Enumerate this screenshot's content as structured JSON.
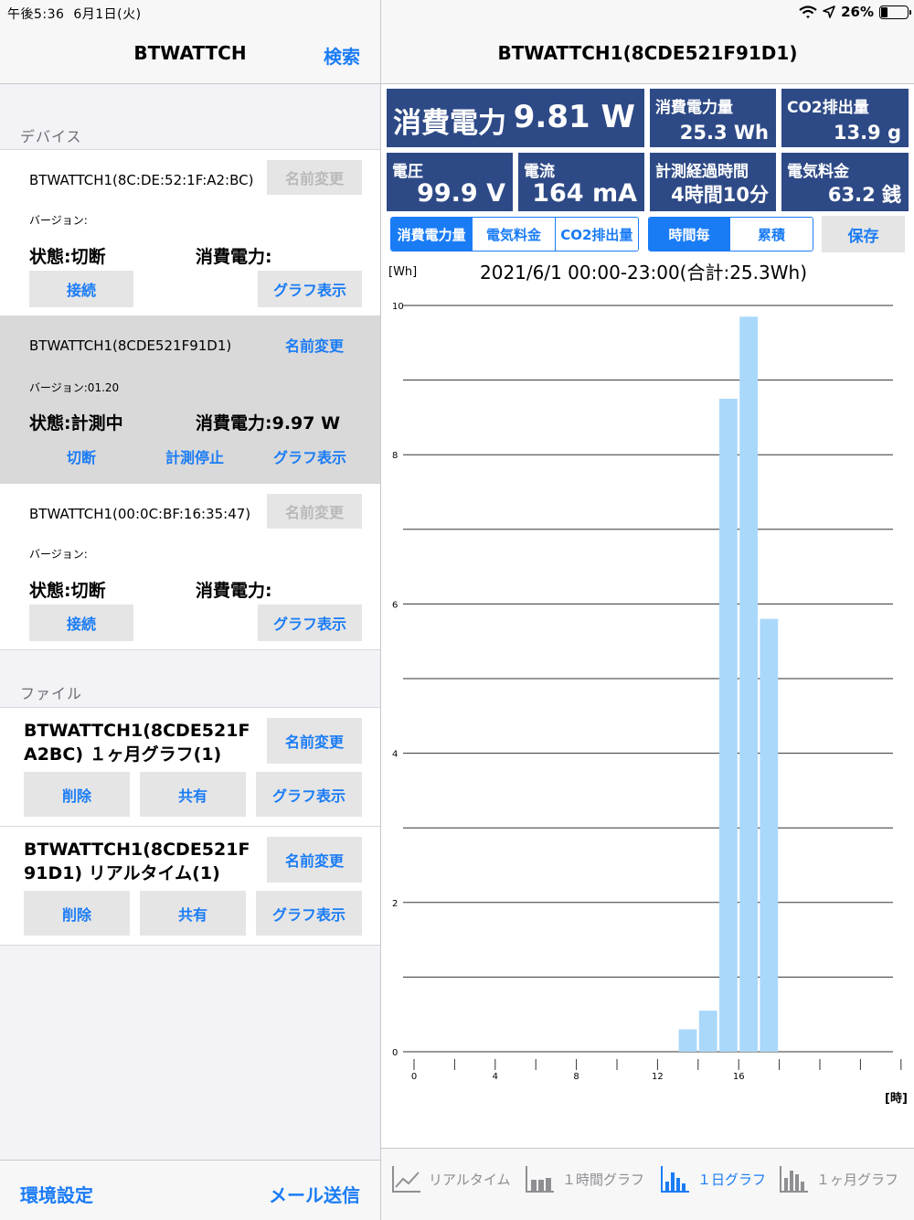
{
  "status": {
    "time": "午後5:36",
    "date": "6月1日(火)",
    "battery": "26%"
  },
  "left": {
    "nav": {
      "title": "BTWATTCH",
      "search_label": "検索"
    },
    "devices_header": "デバイス",
    "devices": [
      {
        "name": "BTWATTCH1(8C:DE:52:1F:A2:BC)",
        "rename": "名前変更",
        "version": "バージョン:",
        "state": "状態:切断",
        "power": "消費電力:",
        "action1": "接続",
        "graph": "グラフ表示"
      },
      {
        "name": "BTWATTCH1(8CDE521F91D1)",
        "rename": "名前変更",
        "version": "バージョン:01.20",
        "state": "状態:計測中",
        "power": "消費電力:9.97 W",
        "action1": "切断",
        "action2": "計測停止",
        "graph": "グラフ表示"
      },
      {
        "name": "BTWATTCH1(00:0C:BF:16:35:47)",
        "rename": "名前変更",
        "version": "バージョン:",
        "state": "状態:切断",
        "power": "消費電力:",
        "action1": "接続",
        "graph": "グラフ表示"
      }
    ],
    "files_header": "ファイル",
    "files": [
      {
        "name": "BTWATTCH1(8CDE521F A2BC) １ヶ月グラフ(1)",
        "rename": "名前変更",
        "delete": "削除",
        "share": "共有",
        "graph": "グラフ表示"
      },
      {
        "name": "BTWATTCH1(8CDE521F 91D1) リアルタイム(1)",
        "rename": "名前変更",
        "delete": "削除",
        "share": "共有",
        "graph": "グラフ表示"
      }
    ],
    "bottom": {
      "settings": "環境設定",
      "mail": "メール送信"
    }
  },
  "right": {
    "nav": {
      "title": "BTWATTCH1(8CDE521F91D1)"
    },
    "tiles": {
      "power": {
        "label": "消費電力",
        "value": "9.81 W"
      },
      "energy": {
        "label": "消費電力量",
        "value": "25.3 Wh"
      },
      "co2": {
        "label": "CO2排出量",
        "value": "13.9 g"
      },
      "voltage": {
        "label": "電圧",
        "value": "99.9 V"
      },
      "current": {
        "label": "電流",
        "value": "164 mA"
      },
      "elapsed": {
        "label": "計測経過時間",
        "value": "4時間10分"
      },
      "cost": {
        "label": "電気料金",
        "value": "63.2 銭"
      }
    },
    "seg_metric": [
      "消費電力量",
      "電気料金",
      "CO2排出量"
    ],
    "seg_mode": [
      "時間毎",
      "累積"
    ],
    "save": "保存",
    "tabs": [
      "リアルタイム",
      "１時間グラフ",
      "１日グラフ",
      "１ヶ月グラフ"
    ]
  },
  "chart_data": {
    "type": "bar",
    "title": "2021/6/1 00:00-23:00(合計:25.3Wh)",
    "xlabel": "[時]",
    "ylabel": "[Wh]",
    "x": [
      0,
      1,
      2,
      3,
      4,
      5,
      6,
      7,
      8,
      9,
      10,
      11,
      12,
      13,
      14,
      15,
      16,
      17,
      18,
      19,
      20,
      21,
      22,
      23
    ],
    "values": [
      0,
      0,
      0,
      0,
      0,
      0,
      0,
      0,
      0,
      0,
      0,
      0,
      0,
      0.3,
      0.55,
      8.75,
      9.85,
      5.8,
      0,
      0,
      0,
      0,
      0,
      0
    ],
    "ylim": [
      0,
      10
    ],
    "yticks": [
      0,
      2,
      4,
      6,
      8,
      10
    ],
    "xticks": [
      0,
      4,
      8,
      12,
      16
    ],
    "bar_color": "#aad8fb",
    "grid": true
  },
  "colors": {
    "accent": "#1a7cf5",
    "tile": "#2e4a86"
  }
}
